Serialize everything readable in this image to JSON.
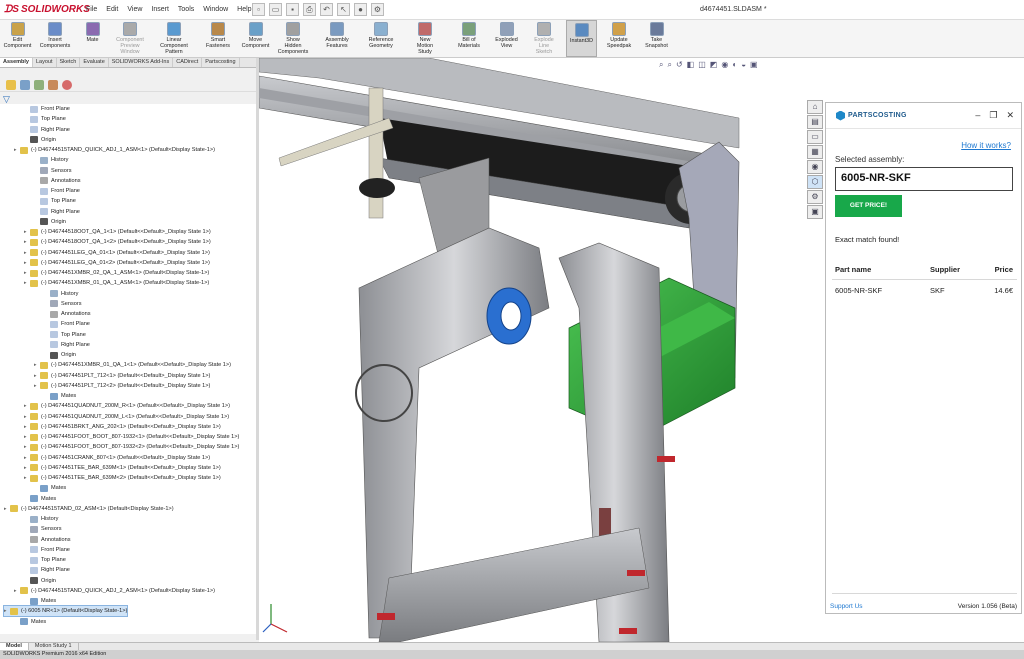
{
  "app": {
    "logo": "SOLIDWORKS",
    "document_title": "d4674451.SLDASM *",
    "menu": [
      "File",
      "Edit",
      "View",
      "Insert",
      "Tools",
      "Window",
      "Help"
    ]
  },
  "commands": [
    {
      "label": "Edit\nComponent"
    },
    {
      "label": "Insert\nComponents"
    },
    {
      "label": "Mate"
    },
    {
      "label": "Component\nPreview\nWindow",
      "disabled": true
    },
    {
      "label": "Linear Component\nPattern"
    },
    {
      "label": "Smart\nFasteners"
    },
    {
      "label": "Move\nComponent"
    },
    {
      "label": "Show\nHidden\nComponents"
    },
    {
      "label": "Assembly\nFeatures"
    },
    {
      "label": "Reference\nGeometry"
    },
    {
      "label": "New\nMotion\nStudy"
    },
    {
      "label": "Bill of\nMaterials"
    },
    {
      "label": "Exploded\nView"
    },
    {
      "label": "Explode\nLine\nSketch",
      "disabled": true
    },
    {
      "label": "Instant3D",
      "active": true
    },
    {
      "label": "Update\nSpeedpak"
    },
    {
      "label": "Take\nSnapshot"
    }
  ],
  "tabs": [
    "Assembly",
    "Layout",
    "Sketch",
    "Evaluate",
    "SOLIDWORKS Add-Ins",
    "CADirect",
    "Partscosting"
  ],
  "tree": [
    {
      "label": "Front Plane",
      "indent": 2
    },
    {
      "label": "Top Plane",
      "indent": 2
    },
    {
      "label": "Right Plane",
      "indent": 2
    },
    {
      "label": "Origin",
      "indent": 2
    },
    {
      "label": "(-) D46744515TAND_QUICK_ADJ_1_ASM<1> (Default<Display State-1>)",
      "indent": 1,
      "expand": true
    },
    {
      "label": "History",
      "indent": 3
    },
    {
      "label": "Sensors",
      "indent": 3
    },
    {
      "label": "Annotations",
      "indent": 3
    },
    {
      "label": "Front Plane",
      "indent": 3
    },
    {
      "label": "Top Plane",
      "indent": 3
    },
    {
      "label": "Right Plane",
      "indent": 3
    },
    {
      "label": "Origin",
      "indent": 3
    },
    {
      "label": "(-) D46744518OOT_QA_1<1> (Default<<Default>_Display State 1>)",
      "indent": 2,
      "expand": true
    },
    {
      "label": "(-) D46744518OOT_QA_1<2> (Default<<Default>_Display State 1>)",
      "indent": 2,
      "expand": true
    },
    {
      "label": "(-) D4674451LEG_QA_01<1> (Default<<Default>_Display State 1>)",
      "indent": 2,
      "expand": true
    },
    {
      "label": "(-) D4674451LEG_QA_01<2> (Default<<Default>_Display State 1>)",
      "indent": 2,
      "expand": true
    },
    {
      "label": "(-) D4674451XMBR_02_QA_1_ASM<1> (Default<Display State-1>)",
      "indent": 2,
      "expand": true
    },
    {
      "label": "(-) D4674451XMBR_01_QA_1_ASM<1> (Default<Display State-1>)",
      "indent": 2,
      "expand": true
    },
    {
      "label": "History",
      "indent": 4
    },
    {
      "label": "Sensors",
      "indent": 4
    },
    {
      "label": "Annotations",
      "indent": 4
    },
    {
      "label": "Front Plane",
      "indent": 4
    },
    {
      "label": "Top Plane",
      "indent": 4
    },
    {
      "label": "Right Plane",
      "indent": 4
    },
    {
      "label": "Origin",
      "indent": 4
    },
    {
      "label": "(-) D4674451XMBR_01_QA_1<1> (Default<<Default>_Display State 1>)",
      "indent": 3,
      "expand": true
    },
    {
      "label": "(-) D4674451PLT_712<1> (Default<<Default>_Display State 1>)",
      "indent": 3,
      "expand": true
    },
    {
      "label": "(-) D4674451PLT_712<2> (Default<<Default>_Display State 1>)",
      "indent": 3,
      "expand": true
    },
    {
      "label": "Mates",
      "indent": 4
    },
    {
      "label": "(-) D4674451QUADNUT_200M_R<1> (Default<<Default>_Display State 1>)",
      "indent": 2,
      "expand": true
    },
    {
      "label": "(-) D4674451QUADNUT_200M_L<1> (Default<<Default>_Display State 1>)",
      "indent": 2,
      "expand": true
    },
    {
      "label": "(-) D4674451BRKT_ANG_202<1> (Default<<Default>_Display State 1>)",
      "indent": 2,
      "expand": true
    },
    {
      "label": "(-) D4674451FOOT_BOOT_807-1932<1> (Default<<Default>_Display State 1>)",
      "indent": 2,
      "expand": true
    },
    {
      "label": "(-) D4674451FOOT_BOOT_807-1932<2> (Default<<Default>_Display State 1>)",
      "indent": 2,
      "expand": true
    },
    {
      "label": "(-) D4674451CRANK_807<1> (Default<<Default>_Display State 1>)",
      "indent": 2,
      "expand": true
    },
    {
      "label": "(-) D4674451TEE_BAR_639M<1> (Default<<Default>_Display State 1>)",
      "indent": 2,
      "expand": true
    },
    {
      "label": "(-) D4674451TEE_BAR_639M<2> (Default<<Default>_Display State 1>)",
      "indent": 2,
      "expand": true
    },
    {
      "label": "Mates",
      "indent": 3
    },
    {
      "label": "Mates",
      "indent": 2
    },
    {
      "label": "(-) D46744515TAND_02_ASM<1> (Default<Display State-1>)",
      "indent": 0,
      "expand": true
    },
    {
      "label": "History",
      "indent": 2
    },
    {
      "label": "Sensors",
      "indent": 2
    },
    {
      "label": "Annotations",
      "indent": 2
    },
    {
      "label": "Front Plane",
      "indent": 2
    },
    {
      "label": "Top Plane",
      "indent": 2
    },
    {
      "label": "Right Plane",
      "indent": 2
    },
    {
      "label": "Origin",
      "indent": 2
    },
    {
      "label": "(-) D46744515TAND_QUICK_ADJ_2_ASM<1> (Default<Display State-1>)",
      "indent": 1,
      "expand": true
    },
    {
      "label": "Mates",
      "indent": 2
    },
    {
      "label": "(-) 6005 NR<1> (Default<Display State-1>)",
      "indent": 0,
      "expand": true,
      "selected": true
    },
    {
      "label": "Mates",
      "indent": 1
    }
  ],
  "bottom_tabs": [
    "Model",
    "Motion Study 1"
  ],
  "status": "SOLIDWORKS Premium 2016 x64 Edition",
  "partscosting": {
    "brand": "PARTSCOSTING",
    "help_link": "How it works?",
    "selected_label": "Selected assembly:",
    "selected_value": "6005-NR-SKF",
    "button": "GET PRICE!",
    "match": "Exact match found!",
    "headers": {
      "part": "Part name",
      "supplier": "Supplier",
      "price": "Price"
    },
    "rows": [
      {
        "part": "6005-NR-SKF",
        "supplier": "SKF",
        "price": "14.6€"
      }
    ],
    "support": "Support Us",
    "version": "Version 1.056 (Beta)"
  },
  "colors": {
    "accent": "#18a84a",
    "link": "#1e78d0",
    "motor": "#2fa43a",
    "belt": "#1c1c1c",
    "bearing": "#2a6fd0"
  }
}
